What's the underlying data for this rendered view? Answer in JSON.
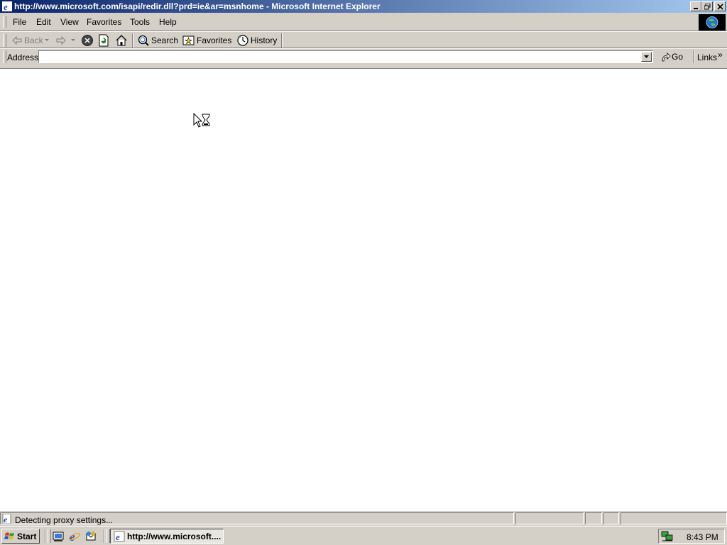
{
  "window": {
    "title": "http://www.microsoft.com/isapi/redir.dll?prd=ie&ar=msnhome - Microsoft Internet Explorer"
  },
  "menu": {
    "items": [
      {
        "label": "File"
      },
      {
        "label": "Edit"
      },
      {
        "label": "View"
      },
      {
        "label": "Favorites"
      },
      {
        "label": "Tools"
      },
      {
        "label": "Help"
      }
    ]
  },
  "toolbar": {
    "back_label": "Back",
    "search_label": "Search",
    "favorites_label": "Favorites",
    "history_label": "History"
  },
  "address": {
    "label": "Address",
    "value": "",
    "go_label": "Go",
    "links_label": "Links",
    "links_chevron": "»"
  },
  "status": {
    "text": "Detecting proxy settings..."
  },
  "taskbar": {
    "start_label": "Start",
    "task_label": "http://www.microsoft....",
    "clock": "8:43 PM"
  },
  "colors": {
    "titlebar_start": "#0a246a",
    "titlebar_end": "#a6caf0",
    "chrome": "#d4d0c8"
  }
}
